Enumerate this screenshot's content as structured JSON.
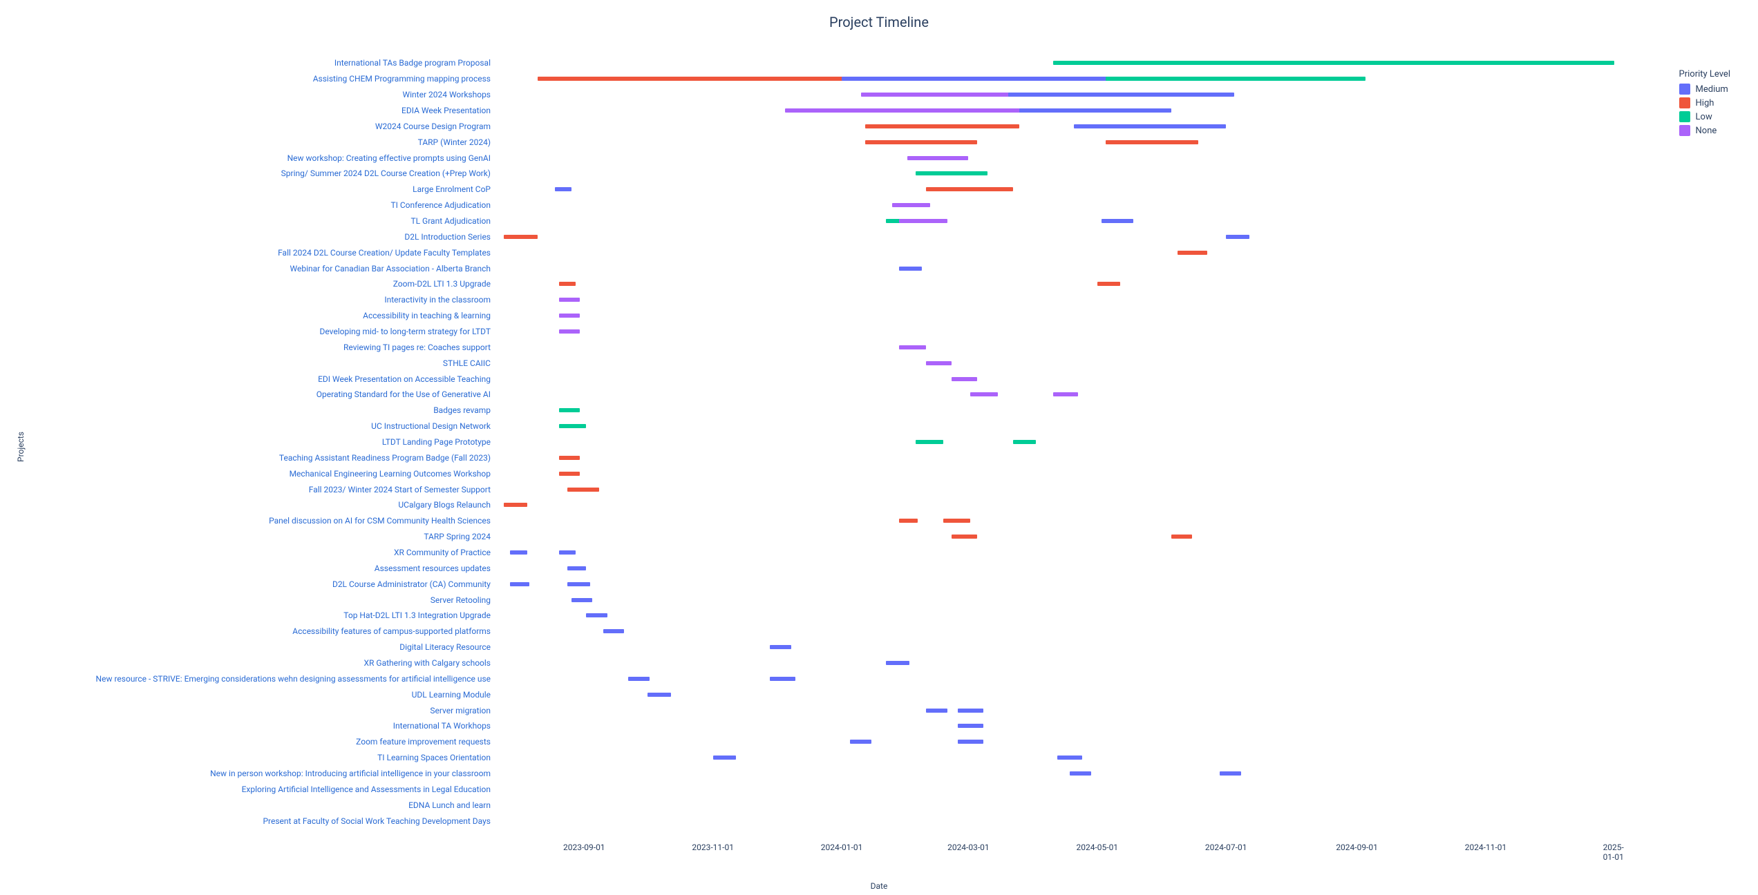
{
  "title": "Project Timeline",
  "xlabel": "Date",
  "ylabel": "Projects",
  "legend_title": "Priority Level",
  "legend": [
    {
      "name": "Medium",
      "color": "#636efa"
    },
    {
      "name": "High",
      "color": "#ef553b"
    },
    {
      "name": "Low",
      "color": "#00cc96"
    },
    {
      "name": "None",
      "color": "#ab63fa"
    }
  ],
  "x_ticks": [
    "2023-09-01",
    "2023-11-01",
    "2024-01-01",
    "2024-03-01",
    "2024-05-01",
    "2024-07-01",
    "2024-09-01",
    "2024-11-01",
    "2025-01-01"
  ],
  "projects": [
    "International TAs Badge program Proposal",
    "Assisting CHEM Programming mapping process",
    "Winter 2024 Workshops",
    "EDIA Week Presentation",
    "W2024 Course Design Program",
    "TARP (Winter 2024)",
    "New workshop:  Creating effective prompts using GenAI",
    "Spring/ Summer 2024 D2L Course Creation (+Prep Work)",
    "Large Enrolment CoP",
    "TI Conference Adjudication",
    "TL Grant Adjudication",
    "D2L Introduction Series",
    "Fall 2024 D2L Course Creation/ Update Faculty Templates",
    "Webinar for Canadian Bar Association - Alberta Branch",
    "Zoom-D2L LTI 1.3 Upgrade",
    "Interactivity in the classroom",
    "Accessibility in teaching & learning",
    "Developing mid- to long-term strategy for LTDT",
    "Reviewing TI pages re: Coaches support",
    "STHLE CAIIC",
    "EDI Week Presentation on Accessible Teaching",
    "Operating Standard for the Use of Generative AI",
    "Badges revamp",
    "UC Instructional Design Network",
    "LTDT Landing Page Prototype",
    "Teaching Assistant Readiness Program Badge (Fall 2023)",
    "Mechanical Engineering Learning Outcomes Workshop",
    "Fall 2023/ Winter 2024 Start of Semester Support",
    "UCalgary Blogs Relaunch",
    "Panel discussion on AI for CSM Community Health Sciences",
    "TARP Spring 2024",
    "XR Community of Practice",
    "Assessment resources updates",
    "D2L Course Administrator (CA) Community",
    "Server Retooling",
    "Top Hat-D2L LTI 1.3 Integration Upgrade",
    "Accessibility features of campus-supported platforms",
    "Digital Literacy Resource",
    "XR Gathering with Calgary schools",
    "New resource - STRIVE: Emerging considerations wehn designing assessments for artificial intelligence use",
    "UDL Learning Module",
    "Server migration",
    "International TA Workhops",
    "Zoom feature improvement requests",
    "TI Learning Spaces Orientation",
    "New in person workshop: Introducing artificial intelligence in your classroom",
    "Exploring Artificial Intelligence and Assessments in Legal Education",
    "EDNA Lunch and learn",
    "Present at Faculty of Social Work Teaching Development Days"
  ],
  "chart_data": {
    "type": "bar",
    "orientation": "horizontal-gantt",
    "title": "Project Timeline",
    "xlabel": "Date",
    "ylabel": "Projects",
    "x_range": [
      "2023-07-22",
      "2025-01-12"
    ],
    "x_ticks": [
      "2023-09-01",
      "2023-11-01",
      "2024-01-01",
      "2024-03-01",
      "2024-05-01",
      "2024-07-01",
      "2024-09-01",
      "2024-11-01",
      "2025-01-01"
    ],
    "series_legend": [
      "Medium",
      "High",
      "Low",
      "None"
    ],
    "colors": {
      "Medium": "#636efa",
      "High": "#ef553b",
      "Low": "#00cc96",
      "None": "#ab63fa"
    },
    "bars": [
      {
        "project": "International TAs Badge program Proposal",
        "start": "2024-04-10",
        "end": "2025-01-01",
        "priority": "Low"
      },
      {
        "project": "Assisting CHEM Programming mapping process",
        "start": "2023-08-10",
        "end": "2024-02-20",
        "priority": "High"
      },
      {
        "project": "Assisting CHEM Programming mapping process",
        "start": "2024-01-01",
        "end": "2024-05-25",
        "priority": "Medium"
      },
      {
        "project": "Assisting CHEM Programming mapping process",
        "start": "2024-05-05",
        "end": "2024-09-05",
        "priority": "Low"
      },
      {
        "project": "Winter 2024 Workshops",
        "start": "2024-01-10",
        "end": "2024-04-08",
        "priority": "None"
      },
      {
        "project": "Winter 2024 Workshops",
        "start": "2024-03-20",
        "end": "2024-07-05",
        "priority": "Medium"
      },
      {
        "project": "EDIA Week Presentation",
        "start": "2023-12-05",
        "end": "2024-04-25",
        "priority": "None"
      },
      {
        "project": "EDIA Week Presentation",
        "start": "2024-03-25",
        "end": "2024-06-05",
        "priority": "Medium"
      },
      {
        "project": "W2024 Course Design Program",
        "start": "2024-01-12",
        "end": "2024-03-25",
        "priority": "High"
      },
      {
        "project": "W2024 Course Design Program",
        "start": "2024-04-20",
        "end": "2024-07-01",
        "priority": "Medium"
      },
      {
        "project": "TARP (Winter 2024)",
        "start": "2024-01-12",
        "end": "2024-03-05",
        "priority": "High"
      },
      {
        "project": "TARP (Winter 2024)",
        "start": "2024-05-05",
        "end": "2024-06-18",
        "priority": "High"
      },
      {
        "project": "New workshop:  Creating effective prompts using GenAI",
        "start": "2024-02-01",
        "end": "2024-03-01",
        "priority": "None"
      },
      {
        "project": "Spring/ Summer 2024 D2L Course Creation (+Prep Work)",
        "start": "2024-02-05",
        "end": "2024-03-10",
        "priority": "Low"
      },
      {
        "project": "Large Enrolment CoP",
        "start": "2023-08-18",
        "end": "2023-08-26",
        "priority": "Medium"
      },
      {
        "project": "Large Enrolment CoP",
        "start": "2024-02-10",
        "end": "2024-03-22",
        "priority": "High"
      },
      {
        "project": "TI Conference Adjudication",
        "start": "2024-01-25",
        "end": "2024-02-12",
        "priority": "None"
      },
      {
        "project": "TL Grant Adjudication",
        "start": "2024-01-22",
        "end": "2024-02-05",
        "priority": "Low"
      },
      {
        "project": "TL Grant Adjudication",
        "start": "2024-01-28",
        "end": "2024-02-20",
        "priority": "None"
      },
      {
        "project": "TL Grant Adjudication",
        "start": "2024-05-03",
        "end": "2024-05-18",
        "priority": "Medium"
      },
      {
        "project": "D2L Introduction Series",
        "start": "2023-07-25",
        "end": "2023-08-10",
        "priority": "High"
      },
      {
        "project": "D2L Introduction Series",
        "start": "2024-07-01",
        "end": "2024-07-12",
        "priority": "Medium"
      },
      {
        "project": "Fall 2024 D2L Course Creation/ Update Faculty Templates",
        "start": "2024-06-08",
        "end": "2024-06-22",
        "priority": "High"
      },
      {
        "project": "Webinar for Canadian Bar Association - Alberta Branch",
        "start": "2024-01-28",
        "end": "2024-02-08",
        "priority": "Medium"
      },
      {
        "project": "Zoom-D2L LTI 1.3 Upgrade",
        "start": "2023-08-20",
        "end": "2023-08-28",
        "priority": "High"
      },
      {
        "project": "Zoom-D2L LTI 1.3 Upgrade",
        "start": "2024-05-01",
        "end": "2024-05-12",
        "priority": "High"
      },
      {
        "project": "Interactivity in the classroom",
        "start": "2023-08-20",
        "end": "2023-08-30",
        "priority": "None"
      },
      {
        "project": "Accessibility in teaching & learning",
        "start": "2023-08-20",
        "end": "2023-08-30",
        "priority": "None"
      },
      {
        "project": "Developing mid- to long-term strategy for LTDT",
        "start": "2023-08-20",
        "end": "2023-08-30",
        "priority": "None"
      },
      {
        "project": "Reviewing TI pages re: Coaches support",
        "start": "2024-01-28",
        "end": "2024-02-10",
        "priority": "None"
      },
      {
        "project": "STHLE CAIIC",
        "start": "2024-02-10",
        "end": "2024-02-22",
        "priority": "None"
      },
      {
        "project": "EDI Week Presentation on Accessible Teaching",
        "start": "2024-02-22",
        "end": "2024-03-05",
        "priority": "None"
      },
      {
        "project": "Operating Standard for the Use of Generative AI",
        "start": "2024-03-02",
        "end": "2024-03-15",
        "priority": "None"
      },
      {
        "project": "Operating Standard for the Use of Generative AI",
        "start": "2024-04-10",
        "end": "2024-04-22",
        "priority": "None"
      },
      {
        "project": "Badges revamp",
        "start": "2023-08-20",
        "end": "2023-08-30",
        "priority": "Low"
      },
      {
        "project": "UC Instructional Design Network",
        "start": "2023-08-20",
        "end": "2023-09-02",
        "priority": "Low"
      },
      {
        "project": "LTDT Landing Page Prototype",
        "start": "2024-02-05",
        "end": "2024-02-18",
        "priority": "Low"
      },
      {
        "project": "LTDT Landing Page Prototype",
        "start": "2024-03-22",
        "end": "2024-04-02",
        "priority": "Low"
      },
      {
        "project": "Teaching Assistant Readiness Program Badge (Fall 2023)",
        "start": "2023-08-20",
        "end": "2023-08-30",
        "priority": "High"
      },
      {
        "project": "Mechanical Engineering Learning Outcomes Workshop",
        "start": "2023-08-20",
        "end": "2023-08-30",
        "priority": "High"
      },
      {
        "project": "Fall 2023/ Winter 2024 Start of Semester Support",
        "start": "2023-08-24",
        "end": "2023-09-08",
        "priority": "High"
      },
      {
        "project": "UCalgary Blogs Relaunch",
        "start": "2023-07-25",
        "end": "2023-08-05",
        "priority": "High"
      },
      {
        "project": "Panel discussion on AI for CSM Community Health Sciences",
        "start": "2024-01-28",
        "end": "2024-02-06",
        "priority": "High"
      },
      {
        "project": "Panel discussion on AI for CSM Community Health Sciences",
        "start": "2024-02-18",
        "end": "2024-03-02",
        "priority": "High"
      },
      {
        "project": "TARP Spring 2024",
        "start": "2024-02-22",
        "end": "2024-03-05",
        "priority": "High"
      },
      {
        "project": "TARP Spring 2024",
        "start": "2024-06-05",
        "end": "2024-06-15",
        "priority": "High"
      },
      {
        "project": "XR Community of Practice",
        "start": "2023-07-28",
        "end": "2023-08-05",
        "priority": "Medium"
      },
      {
        "project": "XR Community of Practice",
        "start": "2023-08-20",
        "end": "2023-08-28",
        "priority": "Medium"
      },
      {
        "project": "Assessment resources updates",
        "start": "2023-08-24",
        "end": "2023-09-02",
        "priority": "Medium"
      },
      {
        "project": "D2L Course Administrator (CA) Community",
        "start": "2023-07-28",
        "end": "2023-08-06",
        "priority": "Medium"
      },
      {
        "project": "D2L Course Administrator (CA) Community",
        "start": "2023-08-24",
        "end": "2023-09-04",
        "priority": "Medium"
      },
      {
        "project": "Server Retooling",
        "start": "2023-08-26",
        "end": "2023-09-05",
        "priority": "Medium"
      },
      {
        "project": "Top Hat-D2L LTI 1.3 Integration Upgrade",
        "start": "2023-09-02",
        "end": "2023-09-12",
        "priority": "Medium"
      },
      {
        "project": "Accessibility features of campus-supported platforms",
        "start": "2023-09-10",
        "end": "2023-09-20",
        "priority": "Medium"
      },
      {
        "project": "Digital Literacy Resource",
        "start": "2023-11-28",
        "end": "2023-12-08",
        "priority": "Medium"
      },
      {
        "project": "XR Gathering with Calgary schools",
        "start": "2024-01-22",
        "end": "2024-02-02",
        "priority": "Medium"
      },
      {
        "project": "New resource - STRIVE: Emerging considerations wehn designing assessments for artificial intelligence use",
        "start": "2023-09-22",
        "end": "2023-10-02",
        "priority": "Medium"
      },
      {
        "project": "New resource - STRIVE: Emerging considerations wehn designing assessments for artificial intelligence use",
        "start": "2023-11-28",
        "end": "2023-12-10",
        "priority": "Medium"
      },
      {
        "project": "UDL Learning Module",
        "start": "2023-10-01",
        "end": "2023-10-12",
        "priority": "Medium"
      },
      {
        "project": "Server migration",
        "start": "2024-02-10",
        "end": "2024-02-20",
        "priority": "Medium"
      },
      {
        "project": "Server migration",
        "start": "2024-02-25",
        "end": "2024-03-08",
        "priority": "Medium"
      },
      {
        "project": "International TA Workhops",
        "start": "2024-02-25",
        "end": "2024-03-08",
        "priority": "Medium"
      },
      {
        "project": "Zoom feature improvement requests",
        "start": "2024-01-05",
        "end": "2024-01-15",
        "priority": "Medium"
      },
      {
        "project": "Zoom feature improvement requests",
        "start": "2024-02-25",
        "end": "2024-03-08",
        "priority": "Medium"
      },
      {
        "project": "TI Learning Spaces Orientation",
        "start": "2023-11-01",
        "end": "2023-11-12",
        "priority": "Medium"
      },
      {
        "project": "TI Learning Spaces Orientation",
        "start": "2024-04-12",
        "end": "2024-04-24",
        "priority": "Medium"
      },
      {
        "project": "New in person workshop: Introducing artificial intelligence in your classroom",
        "start": "2024-04-18",
        "end": "2024-04-28",
        "priority": "Medium"
      },
      {
        "project": "New in person workshop: Introducing artificial intelligence in your classroom",
        "start": "2024-06-28",
        "end": "2024-07-08",
        "priority": "Medium"
      }
    ]
  }
}
